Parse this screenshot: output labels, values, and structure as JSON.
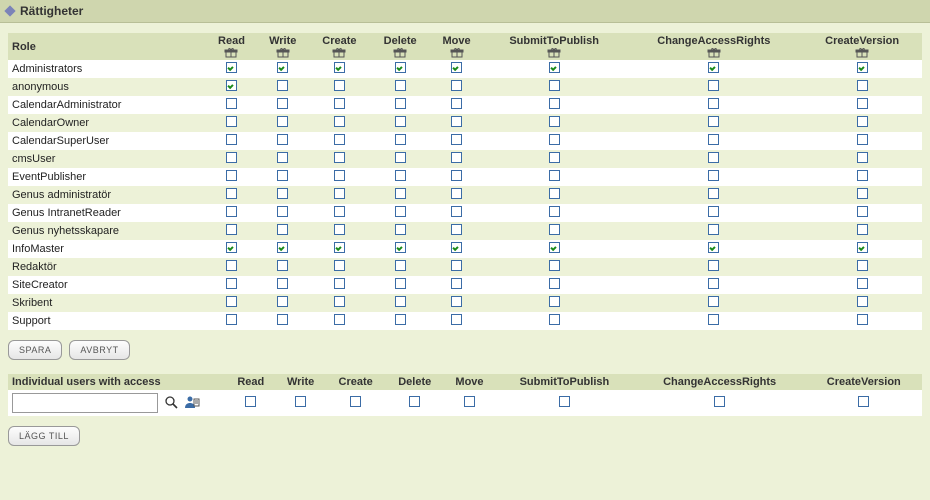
{
  "title": "Rättigheter",
  "columns": {
    "role": "Role",
    "read": "Read",
    "write": "Write",
    "create": "Create",
    "delete": "Delete",
    "move": "Move",
    "submit": "SubmitToPublish",
    "access": "ChangeAccessRights",
    "version": "CreateVersion"
  },
  "roles": [
    {
      "name": "Administrators",
      "perms": [
        true,
        true,
        true,
        true,
        true,
        true,
        true,
        true
      ]
    },
    {
      "name": "anonymous",
      "perms": [
        true,
        false,
        false,
        false,
        false,
        false,
        false,
        false
      ]
    },
    {
      "name": "CalendarAdministrator",
      "perms": [
        false,
        false,
        false,
        false,
        false,
        false,
        false,
        false
      ]
    },
    {
      "name": "CalendarOwner",
      "perms": [
        false,
        false,
        false,
        false,
        false,
        false,
        false,
        false
      ]
    },
    {
      "name": "CalendarSuperUser",
      "perms": [
        false,
        false,
        false,
        false,
        false,
        false,
        false,
        false
      ]
    },
    {
      "name": "cmsUser",
      "perms": [
        false,
        false,
        false,
        false,
        false,
        false,
        false,
        false
      ]
    },
    {
      "name": "EventPublisher",
      "perms": [
        false,
        false,
        false,
        false,
        false,
        false,
        false,
        false
      ]
    },
    {
      "name": "Genus administratör",
      "perms": [
        false,
        false,
        false,
        false,
        false,
        false,
        false,
        false
      ]
    },
    {
      "name": "Genus IntranetReader",
      "perms": [
        false,
        false,
        false,
        false,
        false,
        false,
        false,
        false
      ]
    },
    {
      "name": "Genus nyhetsskapare",
      "perms": [
        false,
        false,
        false,
        false,
        false,
        false,
        false,
        false
      ]
    },
    {
      "name": "InfoMaster",
      "perms": [
        true,
        true,
        true,
        true,
        true,
        true,
        true,
        true
      ]
    },
    {
      "name": "Redaktör",
      "perms": [
        false,
        false,
        false,
        false,
        false,
        false,
        false,
        false
      ]
    },
    {
      "name": "SiteCreator",
      "perms": [
        false,
        false,
        false,
        false,
        false,
        false,
        false,
        false
      ]
    },
    {
      "name": "Skribent",
      "perms": [
        false,
        false,
        false,
        false,
        false,
        false,
        false,
        false
      ]
    },
    {
      "name": "Support",
      "perms": [
        false,
        false,
        false,
        false,
        false,
        false,
        false,
        false
      ]
    }
  ],
  "buttons": {
    "save": "SPARA",
    "cancel": "AVBRYT",
    "add": "LÄGG TILL"
  },
  "individual": {
    "label": "Individual users with access",
    "input_value": "",
    "perms": [
      false,
      false,
      false,
      false,
      false,
      false,
      false,
      false
    ]
  }
}
